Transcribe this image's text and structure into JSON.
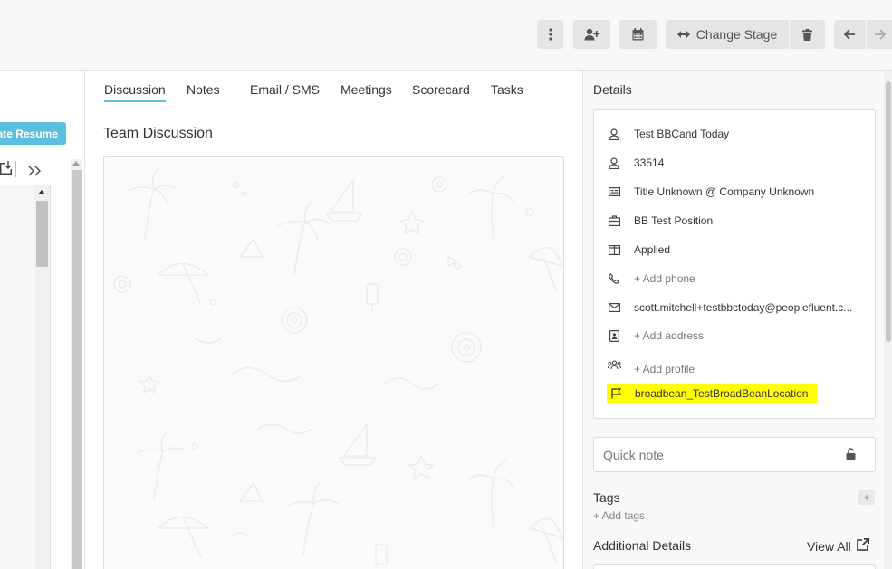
{
  "toolbar": {
    "change_stage_label": "Change Stage"
  },
  "left_panel": {
    "generate_resume_label": "ate Resume"
  },
  "tabs": [
    {
      "label": "Discussion",
      "active": true
    },
    {
      "label": "Notes",
      "active": false
    },
    {
      "label": "Email / SMS",
      "active": false
    },
    {
      "label": "Meetings",
      "active": false
    },
    {
      "label": "Scorecard",
      "active": false
    },
    {
      "label": "Tasks",
      "active": false
    }
  ],
  "discussion": {
    "title": "Team Discussion"
  },
  "details": {
    "title": "Details",
    "rows": [
      {
        "icon": "user-icon",
        "text": "Test BBCand Today"
      },
      {
        "icon": "user-id-icon",
        "text": "33514"
      },
      {
        "icon": "id-card-icon",
        "text": "Title Unknown @ Company Unknown"
      },
      {
        "icon": "briefcase-icon",
        "text": "BB Test Position"
      },
      {
        "icon": "columns-icon",
        "text": "Applied"
      },
      {
        "icon": "phone-icon",
        "text": "+ Add phone"
      },
      {
        "icon": "envelope-icon",
        "text": "scott.mitchell+testbbctoday@peoplefluent.c..."
      },
      {
        "icon": "address-book-icon",
        "text": "+ Add address"
      },
      {
        "icon": "users-icon",
        "text": "+ Add profile"
      },
      {
        "icon": "flag-icon",
        "text": "broadbean_TestBroadBeanLocation"
      }
    ]
  },
  "quick_note": {
    "placeholder": "Quick note"
  },
  "tags": {
    "title": "Tags",
    "add_button": "+",
    "add_link": "+ Add tags"
  },
  "additional_details": {
    "title": "Additional Details",
    "view_all": "View All"
  },
  "colors": {
    "accent": "#5bc0de",
    "highlight": "#ffff00",
    "toolbar_bg": "#f8f8f8",
    "button_bg": "#e5e5e5"
  }
}
